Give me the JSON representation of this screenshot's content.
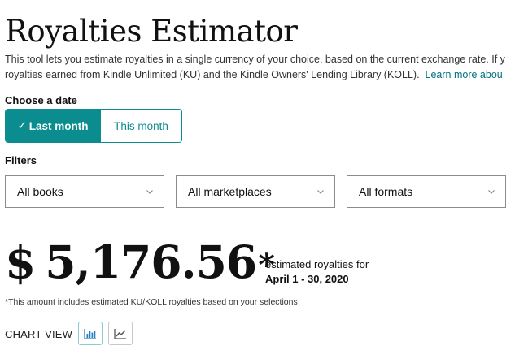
{
  "page": {
    "title": "Royalties Estimator",
    "description_line1": "This tool lets you estimate royalties in a single currency of your choice, based on the current exchange rate. If y",
    "description_line2": "royalties earned from Kindle Unlimited (KU) and the Kindle Owners' Lending Library (KOLL).",
    "learn_more": "Learn more abou"
  },
  "date": {
    "label": "Choose a date",
    "options": [
      {
        "label": "Last month",
        "selected": true
      },
      {
        "label": "This month",
        "selected": false
      }
    ]
  },
  "filters": {
    "label": "Filters",
    "books": "All books",
    "marketplaces": "All marketplaces",
    "formats": "All formats"
  },
  "estimate": {
    "currency": "$",
    "amount": "5,176.56",
    "asterisk": "*",
    "label": "estimated royalties for",
    "period": "April 1 - 30, 2020",
    "footnote": "*This amount includes estimated KU/KOLL royalties based on your selections"
  },
  "chart_view": {
    "label": "CHART VIEW",
    "options": [
      {
        "icon": "bar-chart-icon",
        "active": true
      },
      {
        "icon": "line-chart-icon",
        "active": false
      }
    ]
  },
  "colors": {
    "accent": "#0b8d8f",
    "link": "#007185",
    "icon": "#2b7fbf"
  }
}
